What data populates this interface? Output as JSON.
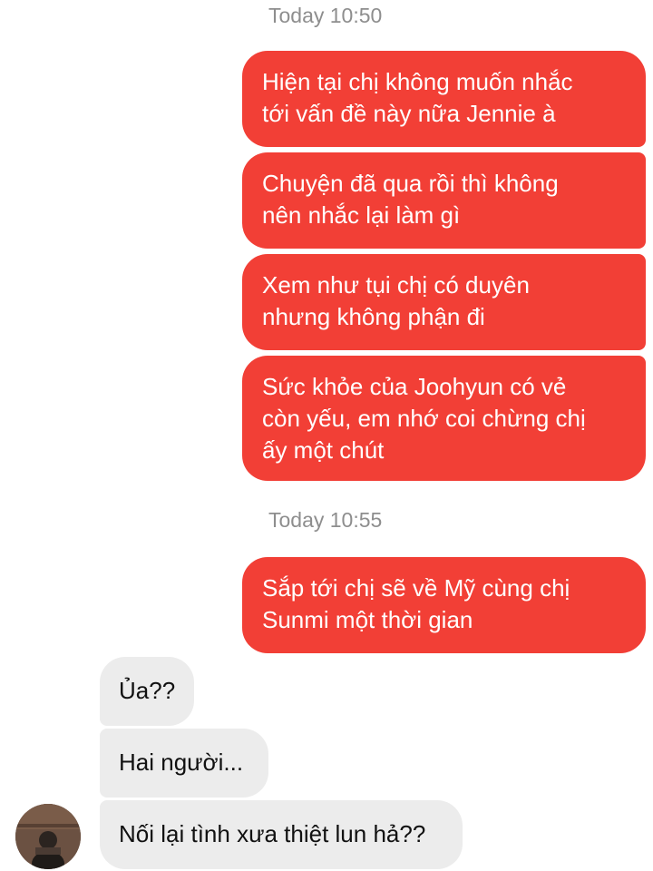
{
  "conversation": {
    "timestamps": [
      "Today 10:50",
      "Today 10:55"
    ],
    "outgoing": [
      {
        "lines": [
          "Hiện tại chị không muốn nhắc",
          "tới vấn đề này nữa Jennie à"
        ]
      },
      {
        "lines": [
          "Chuyện đã qua rồi thì không",
          "nên nhắc lại làm gì"
        ]
      },
      {
        "lines": [
          "Xem như tụi chị có duyên",
          "nhưng không phận đi"
        ]
      },
      {
        "lines": [
          "Sức khỏe của Joohyun có vẻ",
          "còn yếu, em nhớ coi chừng chị",
          "ấy một chút"
        ]
      },
      {
        "lines": [
          "Sắp tới chị sẽ về Mỹ cùng chị",
          "Sunmi một thời gian"
        ]
      }
    ],
    "incoming": [
      {
        "text": "Ủa??"
      },
      {
        "text": "Hai người..."
      },
      {
        "text": "Nối lại tình xưa thiệt lun hả??"
      }
    ]
  },
  "contact": {
    "avatar_icon": "contact-avatar"
  },
  "colors": {
    "outgoing_bubble": "#f23f36",
    "incoming_bubble": "#ececec",
    "timestamp_text": "#8e8e8e"
  }
}
